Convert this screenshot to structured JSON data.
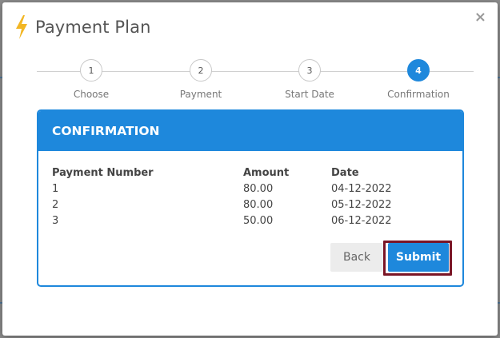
{
  "modal": {
    "title": "Payment Plan",
    "close_symbol": "×",
    "icon": "lightning-bolt-icon",
    "accent_color": "#1e88dc",
    "bolt_color": "#f2b624"
  },
  "stepper": {
    "steps": [
      {
        "number": "1",
        "label": "Choose"
      },
      {
        "number": "2",
        "label": "Payment"
      },
      {
        "number": "3",
        "label": "Start Date"
      },
      {
        "number": "4",
        "label": "Confirmation"
      }
    ],
    "active_step": 4
  },
  "confirmation": {
    "heading": "CONFIRMATION",
    "columns": [
      "Payment Number",
      "Amount",
      "Date"
    ],
    "rows": [
      [
        "1",
        "80.00",
        "04-12-2022"
      ],
      [
        "2",
        "80.00",
        "05-12-2022"
      ],
      [
        "3",
        "50.00",
        "06-12-2022"
      ]
    ],
    "back_label": "Back",
    "submit_label": "Submit"
  }
}
